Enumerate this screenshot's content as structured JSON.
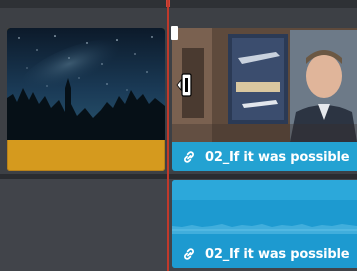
{
  "timeline": {
    "video_track": {
      "clip_left": {
        "color": "#d59a1e",
        "thumbnail": "night-sky-milky-way"
      },
      "clip_right": {
        "label": "02_If it was possible",
        "color": "#23a2d2",
        "thumbnail": "man-interview",
        "linked": true
      }
    },
    "audio_track": {
      "clip": {
        "label": "02_If it was possible",
        "color": "#1d9ad0",
        "linked": true
      }
    },
    "playhead": {
      "color": "#c0392b"
    }
  }
}
